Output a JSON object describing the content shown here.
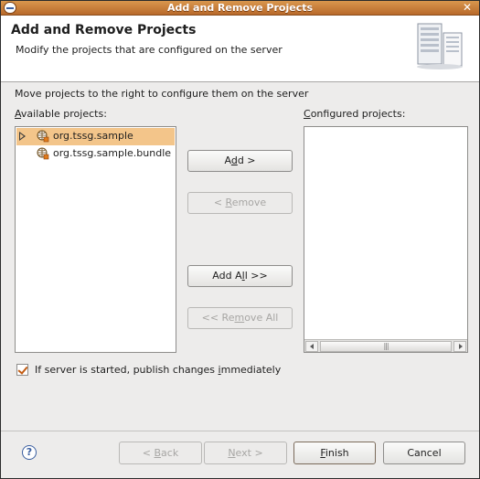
{
  "window": {
    "title": "Add and Remove Projects"
  },
  "header": {
    "title": "Add and Remove Projects",
    "subtitle": "Modify the projects that are configured on the server",
    "image_icon": "server-icon"
  },
  "instructions": "Move projects to the right to configure them on the server",
  "available": {
    "label_prefix": "",
    "label_mnemonic": "A",
    "label_rest": "vailable projects:",
    "items": [
      {
        "label": "org.tssg.sample",
        "selected": true,
        "expandable": true,
        "icon": "web-project-icon"
      },
      {
        "label": "org.tssg.sample.bundle",
        "selected": false,
        "expandable": false,
        "icon": "web-project-icon"
      }
    ]
  },
  "configured": {
    "label_mnemonic": "C",
    "label_rest": "onfigured projects:",
    "items": [],
    "scroll_grip": "|||"
  },
  "buttons": {
    "add": {
      "pre": "A",
      "mn": "d",
      "post": "d >"
    },
    "remove": {
      "pre": "< ",
      "mn": "R",
      "post": "emove"
    },
    "add_all": {
      "pre": "Add A",
      "mn": "l",
      "post": "l >>"
    },
    "remove_all": {
      "pre": "<< Re",
      "mn": "m",
      "post": "ove All"
    }
  },
  "publish_checkbox": {
    "checked": true,
    "pre": "If server is started, publish changes ",
    "mn": "i",
    "post": "mmediately"
  },
  "footer": {
    "help_glyph": "?",
    "back": {
      "pre": "< ",
      "mn": "B",
      "post": "ack"
    },
    "next": {
      "pre": "",
      "mn": "N",
      "post": "ext >"
    },
    "finish": {
      "pre": "",
      "mn": "F",
      "post": "inish"
    },
    "cancel": "Cancel"
  },
  "colors": {
    "titlebar": "#c27c3a",
    "selection": "#f3c58a",
    "checkmark": "#c25b11",
    "dialog_bg": "#edeceb"
  }
}
